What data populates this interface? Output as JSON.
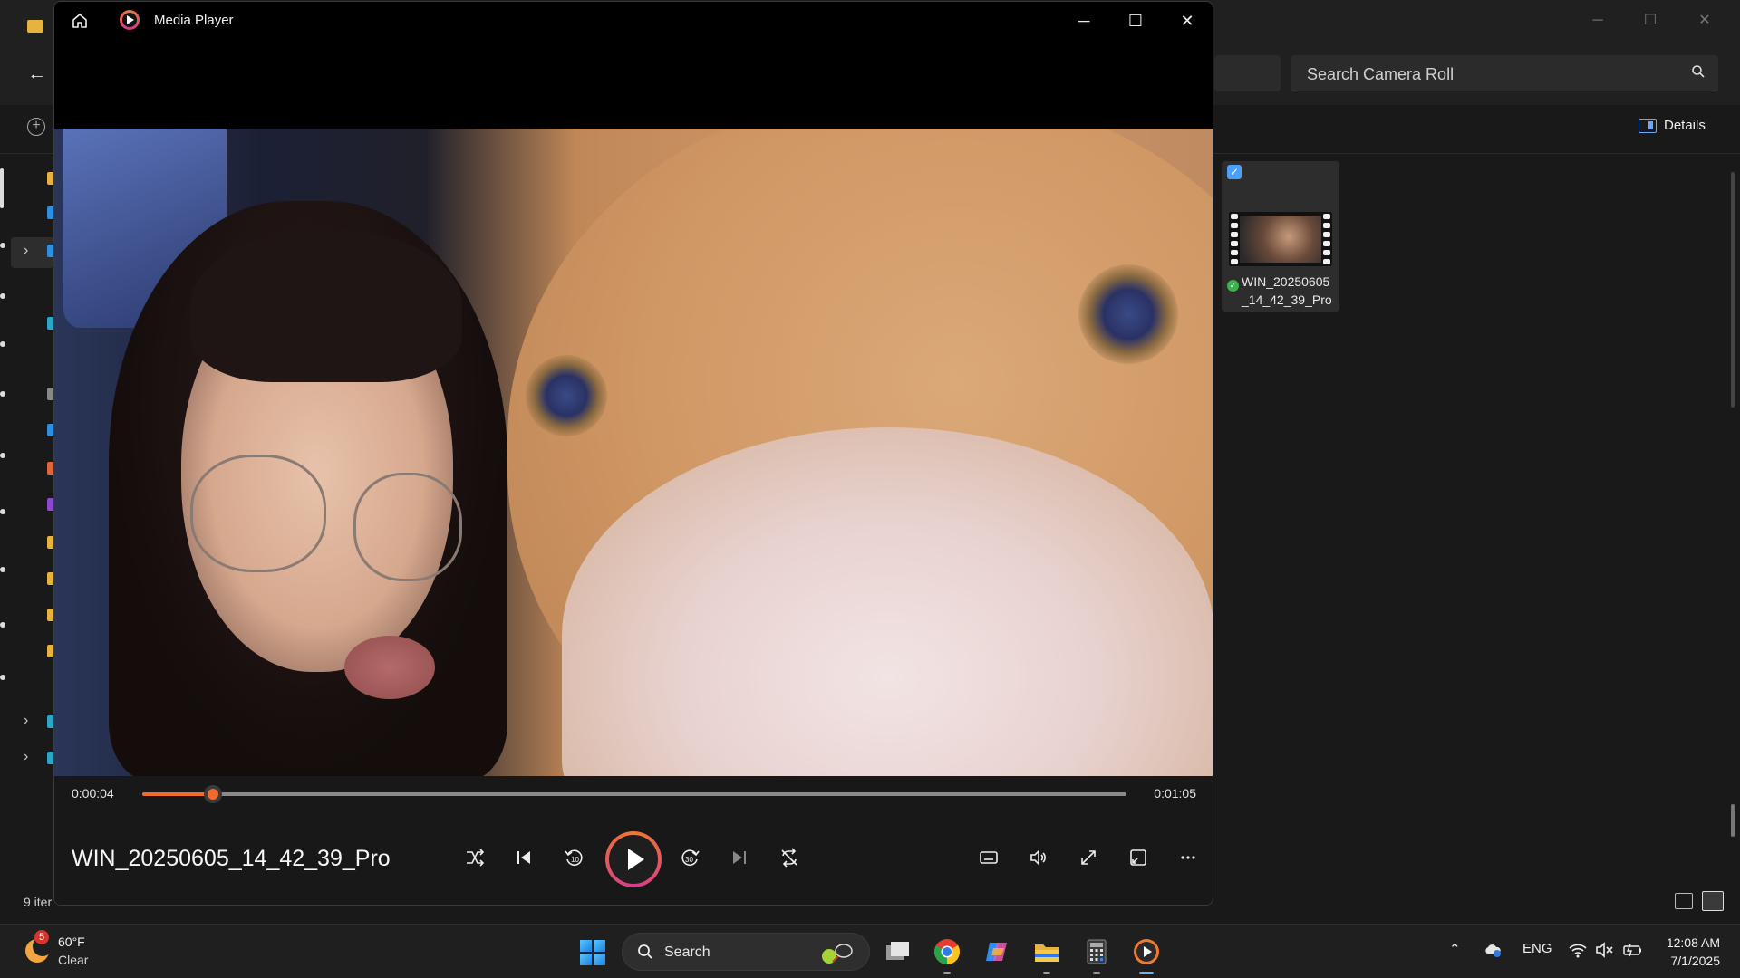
{
  "explorer": {
    "search_placeholder": "Search Camera Roll",
    "details_label": "Details",
    "status_items": "9 iter",
    "file": {
      "name_line1": "WIN_20250605",
      "name_line2": "_14_42_39_Pro"
    },
    "window_controls": {
      "minimize": "─",
      "maximize": "☐",
      "close": "✕"
    }
  },
  "media_player": {
    "app_title": "Media Player",
    "window_controls": {
      "minimize": "─",
      "maximize": "☐",
      "close": "✕"
    },
    "file_title": "WIN_20250605_14_42_39_Pro",
    "time_current": "0:00:04",
    "time_duration": "0:01:05",
    "progress_fraction": 0.072,
    "controls": [
      "shuffle",
      "previous",
      "skip-back-10",
      "play",
      "skip-forward-30",
      "next",
      "repeat",
      "captions",
      "volume",
      "fullscreen",
      "mini-player",
      "more"
    ],
    "accent_color": "#f26b2c"
  },
  "taskbar": {
    "weather_temp": "60°F",
    "weather_condition": "Clear",
    "weather_badge": "5",
    "search_label": "Search",
    "language": "ENG",
    "time": "12:08 AM",
    "date": "7/1/2025",
    "pinned_apps": [
      "task-view",
      "chrome",
      "copilot",
      "file-explorer",
      "calculator",
      "media-player"
    ]
  }
}
